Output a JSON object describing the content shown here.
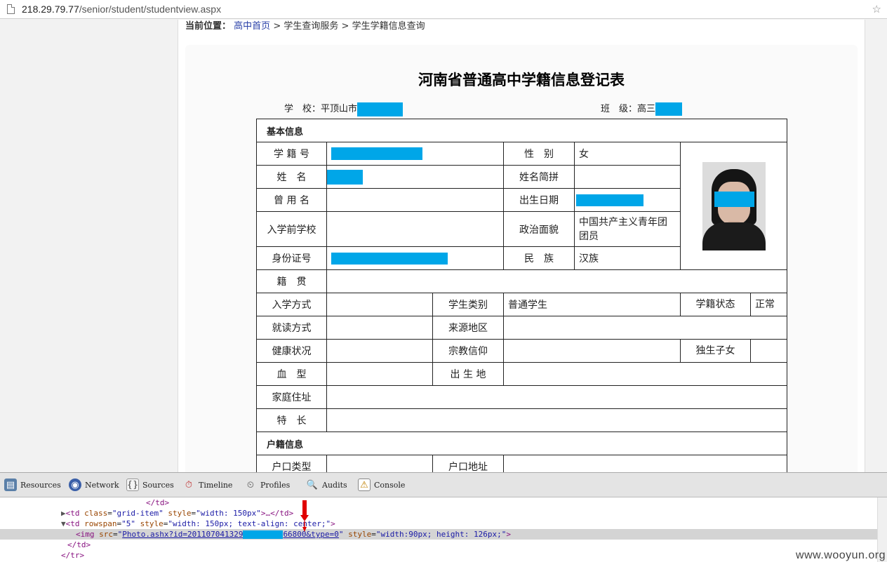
{
  "address_bar": {
    "host": "218.29.79.77",
    "path": "/senior/student/studentview.aspx"
  },
  "breadcrumb": {
    "label": "当前位置：",
    "home": "高中首页",
    "sep1": ">",
    "section": "学生查询服务",
    "sep2": ">",
    "current": "学生学籍信息查询"
  },
  "form": {
    "title": "河南省普通高中学籍信息登记表",
    "school_label": "学　校：",
    "school_value": "平顶山市",
    "class_label": "班　级：",
    "class_value": "高三",
    "sections": {
      "basic": "基本信息",
      "household": "户籍信息"
    },
    "labels": {
      "student_no": "学 籍 号",
      "gender": "性　别",
      "name": "姓　名",
      "name_pinyin": "姓名简拼",
      "former_name": "曾 用 名",
      "birth_date": "出生日期",
      "prev_school": "入学前学校",
      "political": "政治面貌",
      "id_no": "身份证号",
      "ethnicity": "民　族",
      "native_place": "籍　贯",
      "enroll_method": "入学方式",
      "student_type": "学生类别",
      "status": "学籍状态",
      "study_mode": "就读方式",
      "origin_area": "来源地区",
      "health": "健康状况",
      "religion": "宗教信仰",
      "only_child": "独生子女",
      "blood_type": "血　型",
      "birthplace": "出 生 地",
      "home_address": "家庭住址",
      "specialty": "特　长",
      "hukou_type": "户口类型",
      "hukou_address": "户口地址"
    },
    "values": {
      "gender": "女",
      "political": "中国共产主义青年团团员",
      "ethnicity": "汉族",
      "student_type": "普通学生",
      "status": "正常"
    }
  },
  "devtools": {
    "tabs": [
      "Resources",
      "Network",
      "Sources",
      "Timeline",
      "Profiles",
      "Audits",
      "Console"
    ],
    "lines": {
      "l1": "</td>",
      "l2_tag": "<td ",
      "l2_a1": "class",
      "l2_v1": "\"grid-item\"",
      "l2_a2": " style",
      "l2_v2": "\"width: 150px\"",
      "l2_end": ">…</td>",
      "l3_tag": "<td ",
      "l3_a1": "rowspan",
      "l3_v1": "\"5\"",
      "l3_a2": " style",
      "l3_v2": "\"width: 150px; text-align: center;\"",
      "l3_end": ">",
      "l4_tag": "<img ",
      "l4_a1": "src",
      "l4_v1_pre": "\"",
      "l4_link_a": "Photo.ashx?id=201107041329",
      "l4_link_b": "66800&type=0",
      "l4_v1_post": "\"",
      "l4_a2": " style",
      "l4_v2": "\"width:90px; height: 126px;\"",
      "l4_end": ">",
      "l5": "</td>",
      "l6": "</tr>"
    }
  },
  "watermark": "www.wooyun.org",
  "colors": {
    "redaction": "#00a6e8",
    "tag": "#881280",
    "attr_name": "#994500",
    "attr_value": "#1a1aa6",
    "arrow": "#e00000"
  }
}
